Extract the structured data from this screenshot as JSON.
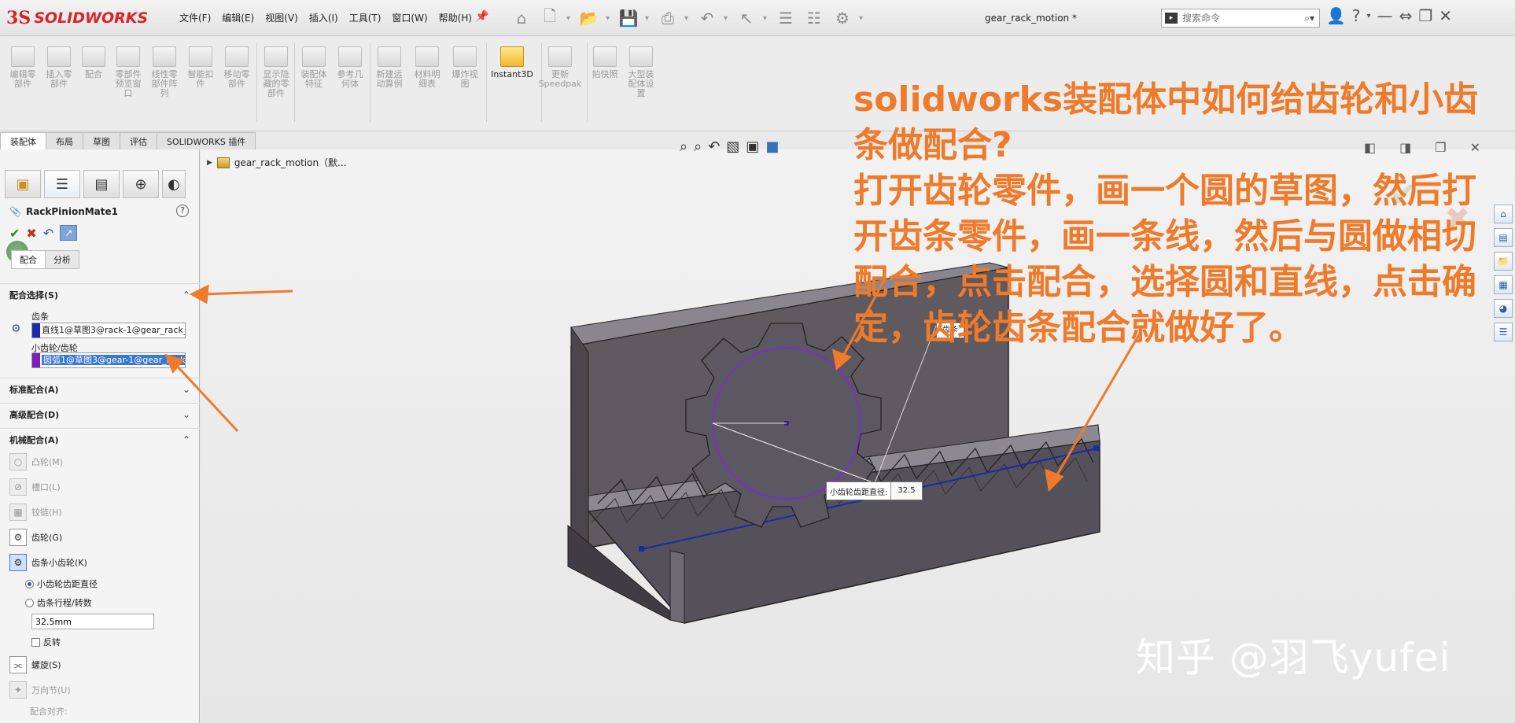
{
  "app": {
    "logo_ds": "3S",
    "logo_name": "SOLIDWORKS",
    "doc_title": "gear_rack_motion *"
  },
  "menu": [
    "文件(F)",
    "编辑(E)",
    "视图(V)",
    "插入(I)",
    "工具(T)",
    "窗口(W)",
    "帮助(H)"
  ],
  "search": {
    "placeholder": "搜索命令"
  },
  "ribbon": [
    {
      "label": "编辑零\n部件",
      "active": false
    },
    {
      "label": "插入零\n部件",
      "active": false
    },
    {
      "label": "配合",
      "active": false
    },
    {
      "label": "零部件\n预览窗\n口",
      "active": false
    },
    {
      "label": "线性零\n部件阵\n列",
      "active": false
    },
    {
      "label": "智能扣\n件",
      "active": false
    },
    {
      "label": "移动零\n部件",
      "active": false
    },
    {
      "label": "显示隐\n藏的零\n部件",
      "active": false
    },
    {
      "label": "装配体\n特征",
      "active": false
    },
    {
      "label": "参考几\n何体",
      "active": false
    },
    {
      "label": "新建运\n动算例",
      "active": false
    },
    {
      "label": "材料明\n细表",
      "active": false
    },
    {
      "label": "爆炸视\n图",
      "active": false
    },
    {
      "label": "Instant3D",
      "active": true
    },
    {
      "label": "更新\nSpeedpak",
      "active": false
    },
    {
      "label": "拍快照",
      "active": false
    },
    {
      "label": "大型装\n配体设\n置",
      "active": false
    }
  ],
  "tabs": [
    {
      "label": "装配体",
      "active": true
    },
    {
      "label": "布局",
      "active": false
    },
    {
      "label": "草图",
      "active": false
    },
    {
      "label": "评估",
      "active": false
    },
    {
      "label": "SOLIDWORKS 插件",
      "active": false
    }
  ],
  "pm": {
    "title": "RackPinionMate1",
    "help": "?",
    "subtabs": [
      {
        "label": "配合",
        "active": true
      },
      {
        "label": "分析",
        "active": false
      }
    ],
    "sections": {
      "selection": "配合选择(S)",
      "standard": "标准配合(A)",
      "advanced": "高级配合(D)",
      "mechanical": "机械配合(A)"
    },
    "rack_label": "齿条",
    "rack_value": "直线1@草图3@rack-1@gear_rack_",
    "pinion_label": "小齿轮/齿轮",
    "pinion_value": "圆弧1@草图3@gear-1@gear_rack_",
    "mechanical": [
      {
        "label": "凸轮(M)",
        "enabled": false,
        "icon": "cam-icon"
      },
      {
        "label": "槽口(L)",
        "enabled": false,
        "icon": "slot-icon"
      },
      {
        "label": "铰链(H)",
        "enabled": false,
        "icon": "hinge-icon"
      },
      {
        "label": "齿轮(G)",
        "enabled": true,
        "icon": "gear-icon"
      },
      {
        "label": "齿条小齿轮(K)",
        "enabled": true,
        "selected": true,
        "icon": "rack-pinion-icon"
      }
    ],
    "radio_pitch": "小齿轮齿距直径",
    "radio_travel": "齿条行程/转数",
    "distance_value": "32.5mm",
    "reverse_label": "反转",
    "screw_label": "螺旋(S)",
    "universal_label": "万向节(U)",
    "align_label": "配合对齐:"
  },
  "viewport": {
    "tree_label": "gear_rack_motion（默...",
    "dim_label": "小齿轮齿距直径:",
    "dim_value": "32.5",
    "dim_tag": "齿条"
  },
  "overlay": {
    "text": "solidworks装配体中如何给齿轮和小齿条做配合?\n打开齿轮零件，画一个圆的草图，然后打开齿条零件，画一条线，然后与圆做相切配合，点击配合，选择圆和直线，点击确定，齿轮齿条配合就做好了。",
    "watermark": "知乎 @羽飞yufei",
    "color": "#ee7a2a"
  }
}
